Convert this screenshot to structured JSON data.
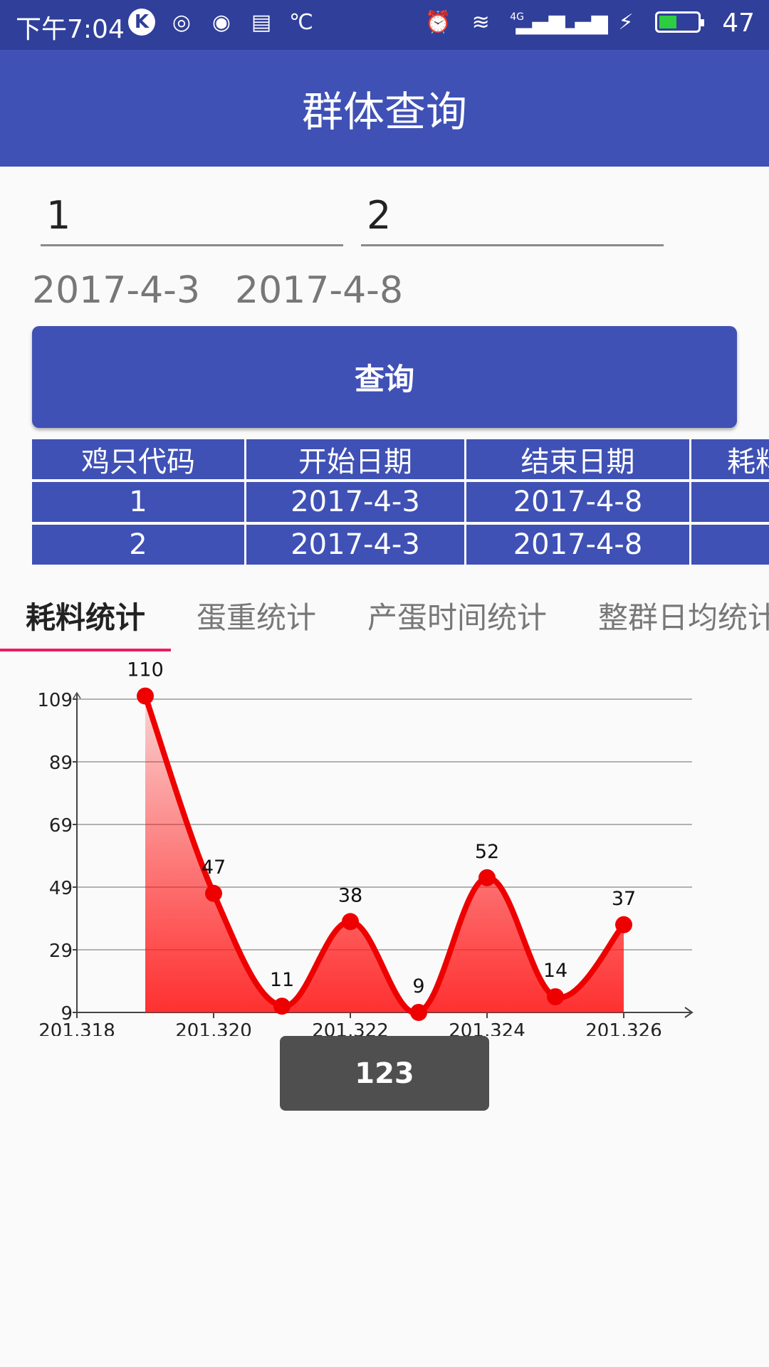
{
  "status_bar": {
    "time": "下午7:04",
    "battery_level": "47",
    "battery_fill_fraction": 0.47,
    "network_badge": "4G",
    "left_icons": [
      "k-app-icon",
      "weibo-icon",
      "qq-icon",
      "news-icon",
      "weather-icon"
    ],
    "right_icons": [
      "alarm-icon",
      "wifi-icon",
      "signal-icon",
      "signal-icon",
      "charging-icon",
      "battery-icon"
    ]
  },
  "app_bar": {
    "title": "群体查询"
  },
  "form": {
    "chicken_code_1": "1",
    "chicken_code_2": "2",
    "start_date": "2017-4-3",
    "end_date": "2017-4-8",
    "query_button": "查询"
  },
  "table": {
    "headers": [
      "鸡只代码",
      "开始日期",
      "结束日期",
      "耗料"
    ],
    "rows": [
      [
        "1",
        "2017-4-3",
        "2017-4-8",
        ""
      ],
      [
        "2",
        "2017-4-3",
        "2017-4-8",
        ""
      ]
    ]
  },
  "tabs": [
    "耗料统计",
    "蛋重统计",
    "产蛋时间统计",
    "整群日均统计"
  ],
  "active_tab": 0,
  "colors": {
    "primary": "#3f51b5",
    "status_bar": "#2f3f9a",
    "accent": "#e91e63",
    "series": "#ee0000"
  },
  "chart_data": {
    "type": "area",
    "x": [
      201319,
      201320,
      201321,
      201322,
      201323,
      201324,
      201325,
      201326
    ],
    "values": [
      110,
      47,
      11,
      38,
      9,
      52,
      14,
      37
    ],
    "data_labels": [
      "110",
      "47",
      "11",
      "38",
      "9",
      "52",
      "14",
      "37"
    ],
    "x_ticks": [
      201318,
      201320,
      201322,
      201324,
      201326
    ],
    "x_tick_labels": [
      "201,318",
      "201,320",
      "201,322",
      "201,324",
      "201,326"
    ],
    "y_ticks": [
      9,
      29,
      49,
      69,
      89,
      109
    ],
    "y_tick_labels": [
      "9",
      "29",
      "49",
      "69",
      "89",
      "109"
    ],
    "xlim": [
      201318,
      201327
    ],
    "ylim": [
      9,
      109
    ],
    "grid": true,
    "smooth": true
  },
  "toast": {
    "text": "123"
  }
}
